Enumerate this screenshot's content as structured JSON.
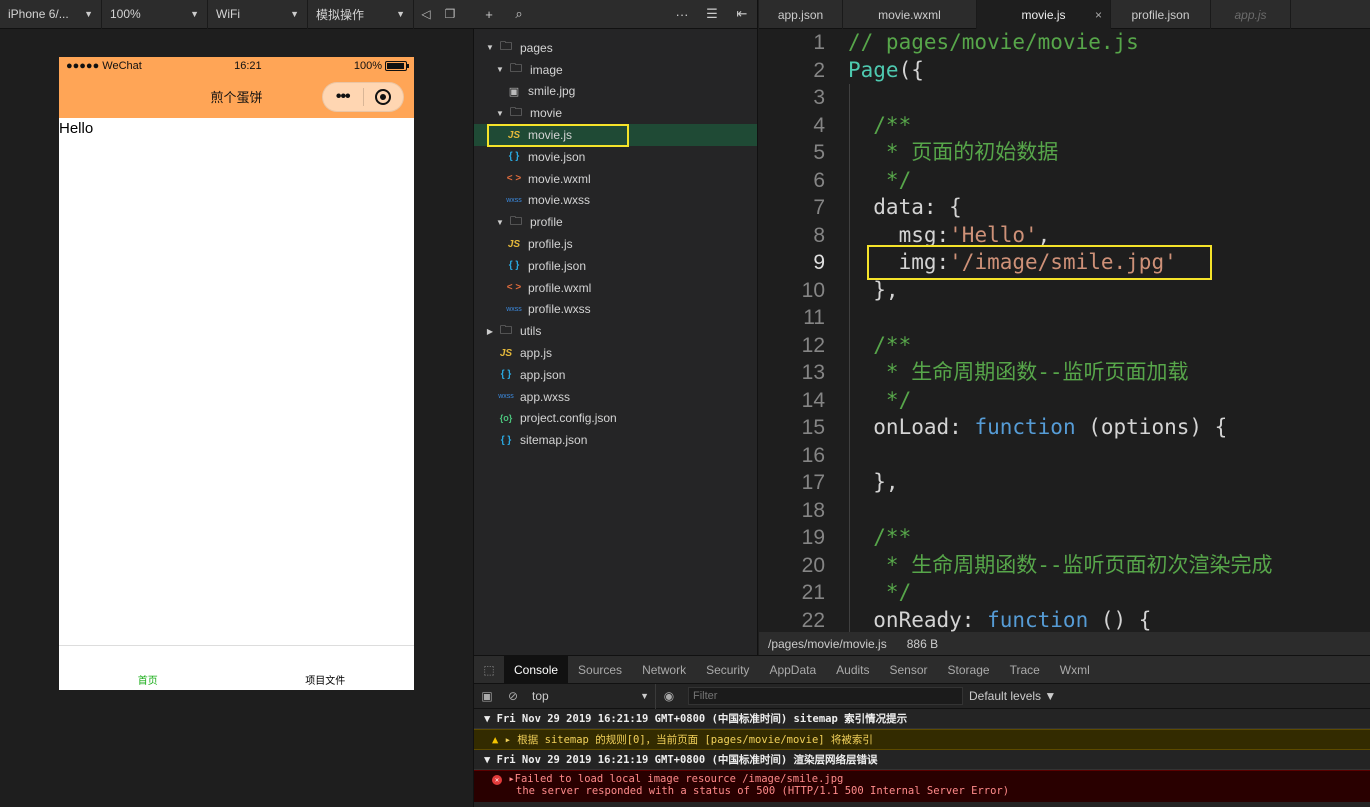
{
  "simulator_toolbar": {
    "device": "iPhone 6/...",
    "zoom": "100%",
    "network": "WiFi",
    "action": "模拟操作"
  },
  "phone": {
    "carrier": "●●●●● WeChat",
    "time": "16:21",
    "battery": "100%",
    "nav_title": "煎个蛋饼",
    "capsule_dots": "•••",
    "body_text": "Hello",
    "tabbar": [
      {
        "label": "首页",
        "color": "#1aad19"
      },
      {
        "label": "项目文件",
        "color": "#000000"
      }
    ]
  },
  "file_tree": [
    {
      "label": "pages",
      "type": "folder",
      "level": 0,
      "open": true
    },
    {
      "label": "image",
      "type": "folder",
      "level": 1,
      "open": true
    },
    {
      "label": "smile.jpg",
      "type": "img",
      "level": 2
    },
    {
      "label": "movie",
      "type": "folder",
      "level": 1,
      "open": true
    },
    {
      "label": "movie.js",
      "type": "js",
      "level": 2,
      "active": true
    },
    {
      "label": "movie.json",
      "type": "json",
      "level": 2
    },
    {
      "label": "movie.wxml",
      "type": "wxml",
      "level": 2
    },
    {
      "label": "movie.wxss",
      "type": "wxss",
      "level": 2
    },
    {
      "label": "profile",
      "type": "folder",
      "level": 1,
      "open": true
    },
    {
      "label": "profile.js",
      "type": "js",
      "level": 2
    },
    {
      "label": "profile.json",
      "type": "json",
      "level": 2
    },
    {
      "label": "profile.wxml",
      "type": "wxml",
      "level": 2
    },
    {
      "label": "profile.wxss",
      "type": "wxss",
      "level": 2
    },
    {
      "label": "utils",
      "type": "folder",
      "level": 0,
      "open": false
    },
    {
      "label": "app.js",
      "type": "js",
      "level": 0
    },
    {
      "label": "app.json",
      "type": "json",
      "level": 0
    },
    {
      "label": "app.wxss",
      "type": "wxss",
      "level": 0
    },
    {
      "label": "project.config.json",
      "type": "cfg",
      "level": 0
    },
    {
      "label": "sitemap.json",
      "type": "json",
      "level": 0
    }
  ],
  "icon_glyphs": {
    "js": "JS",
    "json": "{ }",
    "wxml": "< >",
    "wxss": "wxss",
    "cfg": "{o}",
    "img": "▣",
    "folder": "🗀"
  },
  "editor_tabs": [
    {
      "label": "app.json"
    },
    {
      "label": "movie.wxml"
    },
    {
      "label": "movie.js",
      "active": true,
      "close": "×"
    },
    {
      "label": "profile.json"
    },
    {
      "label": "app.js",
      "ghost": true
    }
  ],
  "code_lines": [
    [
      [
        "c-cmt",
        "// pages/movie/movie.js"
      ]
    ],
    [
      [
        "c-fn",
        "Page"
      ],
      [
        "",
        "({"
      ]
    ],
    [],
    [
      [
        "c-cmt",
        "  /**"
      ]
    ],
    [
      [
        "c-cmt",
        "   * 页面的初始数据"
      ]
    ],
    [
      [
        "c-cmt",
        "   */"
      ]
    ],
    [
      [
        "",
        "  data: {"
      ]
    ],
    [
      [
        "",
        "    msg:"
      ],
      [
        "c-str",
        "'Hello'"
      ],
      [
        "",
        ","
      ]
    ],
    [
      [
        "",
        "    img:"
      ],
      [
        "c-str",
        "'/image/smile.jpg'"
      ]
    ],
    [
      [
        "",
        "  },"
      ]
    ],
    [],
    [
      [
        "c-cmt",
        "  /**"
      ]
    ],
    [
      [
        "c-cmt",
        "   * 生命周期函数--监听页面加载"
      ]
    ],
    [
      [
        "c-cmt",
        "   */"
      ]
    ],
    [
      [
        "",
        "  onLoad: "
      ],
      [
        "c-kw",
        "function"
      ],
      [
        "",
        " (options) {"
      ]
    ],
    [],
    [
      [
        "",
        "  },"
      ]
    ],
    [],
    [
      [
        "c-cmt",
        "  /**"
      ]
    ],
    [
      [
        "c-cmt",
        "   * 生命周期函数--监听页面初次渲染完成"
      ]
    ],
    [
      [
        "c-cmt",
        "   */"
      ]
    ],
    [
      [
        "",
        "  onReady: "
      ],
      [
        "c-kw",
        "function"
      ],
      [
        "",
        " () {"
      ]
    ]
  ],
  "current_line": 9,
  "editor_status": {
    "path": "/pages/movie/movie.js",
    "size": "886 B"
  },
  "devtools": {
    "tabs": [
      "Console",
      "Sources",
      "Network",
      "Security",
      "AppData",
      "Audits",
      "Sensor",
      "Storage",
      "Trace",
      "Wxml"
    ],
    "active_tab": "Console",
    "context": "top",
    "filter_placeholder": "Filter",
    "levels": "Default levels ▼"
  },
  "logs": {
    "group1": "▼ Fri Nov 29 2019 16:21:19 GMT+0800 (中国标准时间) sitemap 索引情况提示",
    "warn": "根据 sitemap 的规则[0]，当前页面 [pages/movie/movie] 将被索引",
    "group2": "▼ Fri Nov 29 2019 16:21:19 GMT+0800 (中国标准时间) 渲染层网络层错误",
    "err1": "Failed to load local image resource /image/smile.jpg",
    "err2": "the server responded with a status of 500 (HTTP/1.1 500 Internal Server Error)"
  },
  "colors": {
    "nav_bg": "#ffa556",
    "highlight": "#f5e32a",
    "active_file_bg": "#1f4a35"
  }
}
